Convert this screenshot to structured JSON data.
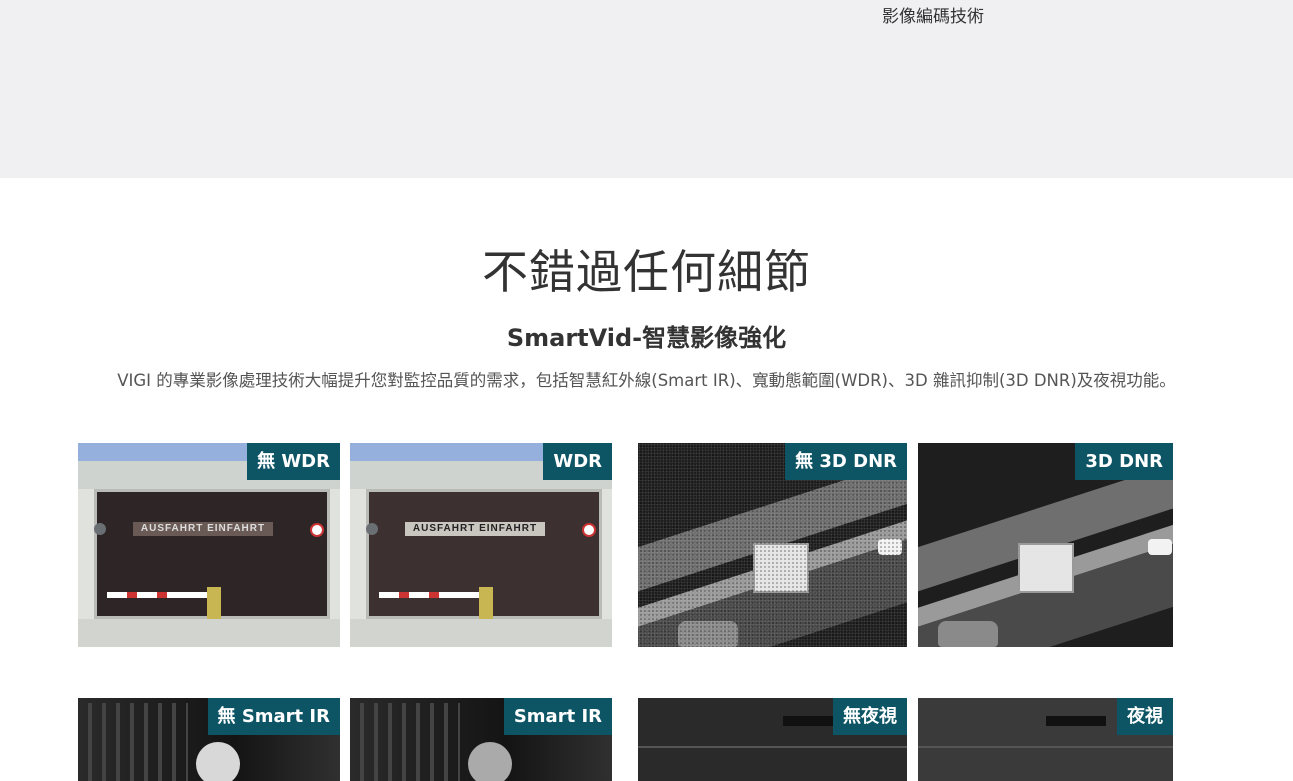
{
  "top_band": {
    "caption": "影像編碼技術"
  },
  "section": {
    "title": "不錯過任何細節",
    "subtitle": "SmartVid-智慧影像強化",
    "description": "VIGI 的專業影像處理技術大幅提升您對監控品質的需求，包括智慧紅外線(Smart IR)、寬動態範圍(WDR)、3D 雜訊抑制(3D DNR)及夜視功能。"
  },
  "tiles": {
    "no_wdr": {
      "badge": "無 WDR",
      "sign": "AUSFAHRT EINFAHRT"
    },
    "wdr": {
      "badge": "WDR",
      "sign": "AUSFAHRT EINFAHRT"
    },
    "no_3d_dnr": {
      "badge": "無 3D DNR"
    },
    "dnr_3d": {
      "badge": "3D DNR"
    },
    "no_smart_ir": {
      "badge": "無 Smart IR"
    },
    "smart_ir": {
      "badge": "Smart IR"
    },
    "no_night_vision": {
      "badge": "無夜視"
    },
    "night_vision": {
      "badge": "夜視"
    }
  },
  "colors": {
    "badge_bg": "#0d5565",
    "top_band_bg": "#f0f0f2"
  }
}
